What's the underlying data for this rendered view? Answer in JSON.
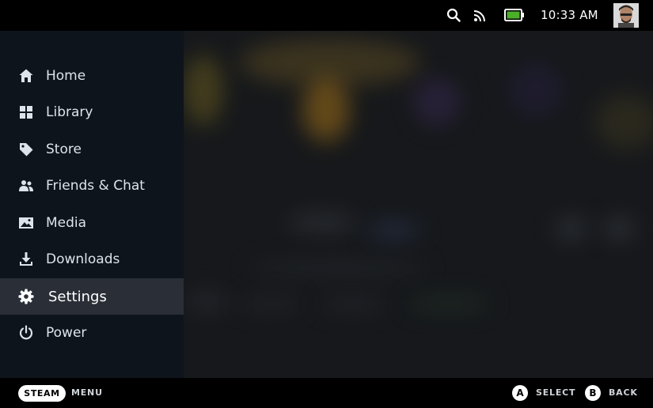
{
  "status_bar": {
    "time": "10:33 AM",
    "battery_color": "#4caf2a"
  },
  "sidebar": {
    "items": [
      {
        "label": "Home",
        "icon": "home-icon"
      },
      {
        "label": "Library",
        "icon": "grid-icon"
      },
      {
        "label": "Store",
        "icon": "tag-icon"
      },
      {
        "label": "Friends & Chat",
        "icon": "people-icon"
      },
      {
        "label": "Media",
        "icon": "image-icon"
      },
      {
        "label": "Downloads",
        "icon": "download-icon"
      },
      {
        "label": "Settings",
        "icon": "gear-icon",
        "selected": true
      },
      {
        "label": "Power",
        "icon": "power-icon"
      }
    ]
  },
  "footer": {
    "steam_label": "STEAM",
    "menu_label": "MENU",
    "a_button": "A",
    "select_label": "SELECT",
    "b_button": "B",
    "back_label": "BACK"
  }
}
